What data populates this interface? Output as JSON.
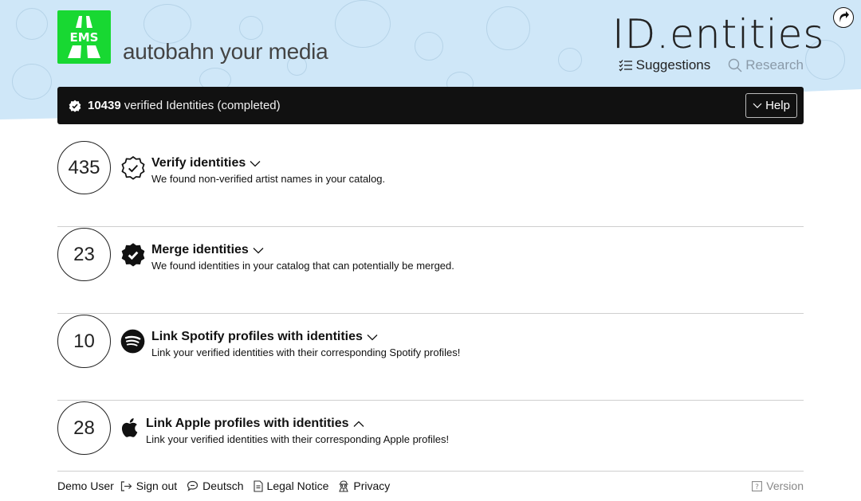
{
  "brand": {
    "logo_text": "EMS",
    "tagline": "autobahn your media",
    "logo_color": "#18d832"
  },
  "app": {
    "title": "ID.entities"
  },
  "nav": {
    "items": [
      {
        "label": "Suggestions",
        "icon": "checklist-icon",
        "active": true
      },
      {
        "label": "Research",
        "icon": "search-icon",
        "active": false
      }
    ]
  },
  "status": {
    "count": "10439",
    "label": "verified Identities (completed)",
    "help_label": "Help"
  },
  "tasks": [
    {
      "count": "435",
      "icon": "badge-check-outline-icon",
      "title": "Verify identities",
      "expanded": false,
      "description": "We found non-verified artist names in your catalog."
    },
    {
      "count": "23",
      "icon": "badge-check-filled-icon",
      "title": "Merge identities",
      "expanded": false,
      "description": "We found identities in your catalog that can potentially be merged."
    },
    {
      "count": "10",
      "icon": "spotify-icon",
      "title": "Link Spotify profiles with identities",
      "expanded": false,
      "description": "Link your verified identities with their corresponding Spotify profiles!"
    },
    {
      "count": "28",
      "icon": "apple-icon",
      "title": "Link Apple profiles with identities",
      "expanded": true,
      "description": "Link your verified identities with their corresponding Apple profiles!"
    }
  ],
  "footer": {
    "user": "Demo User",
    "sign_out": "Sign out",
    "language": "Deutsch",
    "legal": "Legal Notice",
    "privacy": "Privacy",
    "version": "Version"
  }
}
